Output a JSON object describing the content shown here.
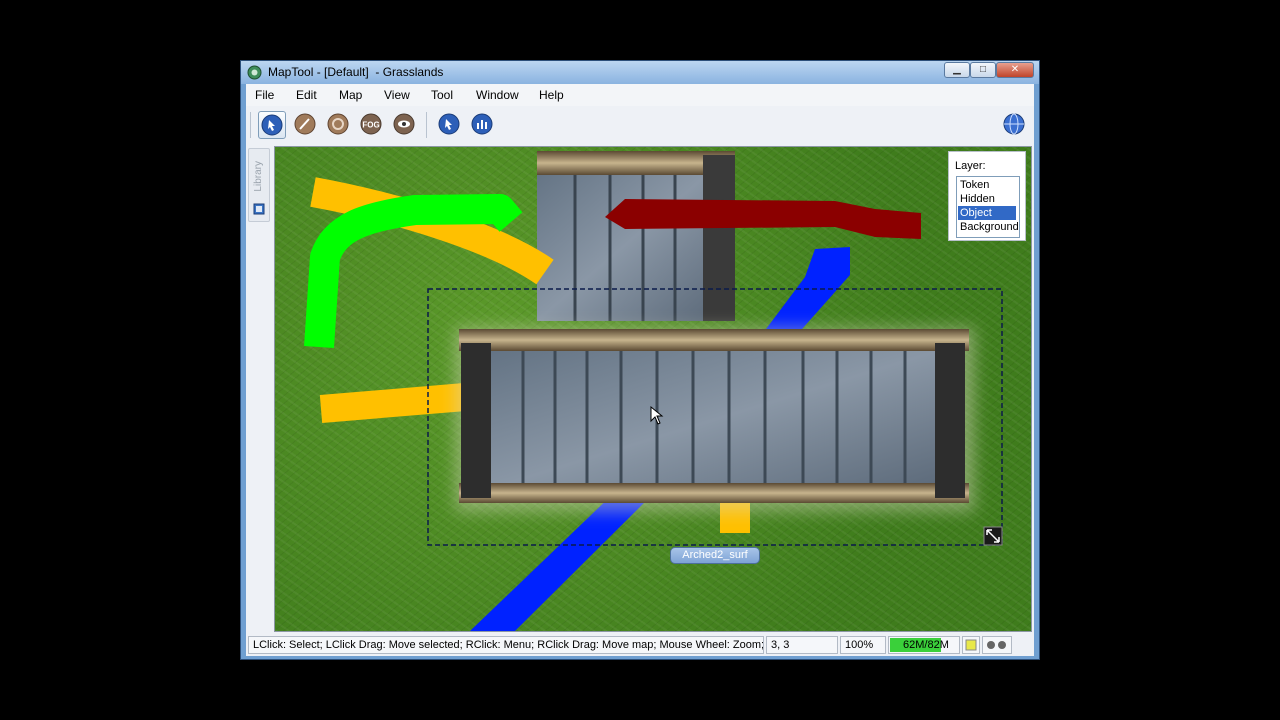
{
  "window": {
    "title": "MapTool - [Default]  - Grasslands"
  },
  "menu": [
    "File",
    "Edit",
    "Map",
    "View",
    "Tool",
    "Window",
    "Help"
  ],
  "toolbar": {
    "tools": [
      "pointer-tool-icon",
      "draw-tool-icon",
      "template-tool-icon",
      "fog-tool-icon",
      "vision-tool-icon",
      "pointer-tool-2-icon",
      "stats-tool-icon",
      "globe-icon"
    ],
    "fog_label": "FOG"
  },
  "sidebar": {
    "library_tab": "Library"
  },
  "layer_panel": {
    "title": "Layer:",
    "options": [
      "Token",
      "Hidden",
      "Object",
      "Background"
    ],
    "selected": "Object"
  },
  "map": {
    "selected_token_label": "Arched2_surf"
  },
  "status": {
    "hint": "LClick: Select; LClick Drag: Move selected; RClick: Menu; RClick Drag: Move map; Mouse Wheel: Zoom; ...",
    "coords": "3, 3",
    "zoom": "100%",
    "memory": "62M/82M",
    "memory_fraction": 0.75
  },
  "colors": {
    "path_yellow": "#ffc000",
    "path_green": "#00ff00",
    "path_red": "#8b0000",
    "path_blue": "#0022ff",
    "selection_highlight": "#3169c6"
  }
}
